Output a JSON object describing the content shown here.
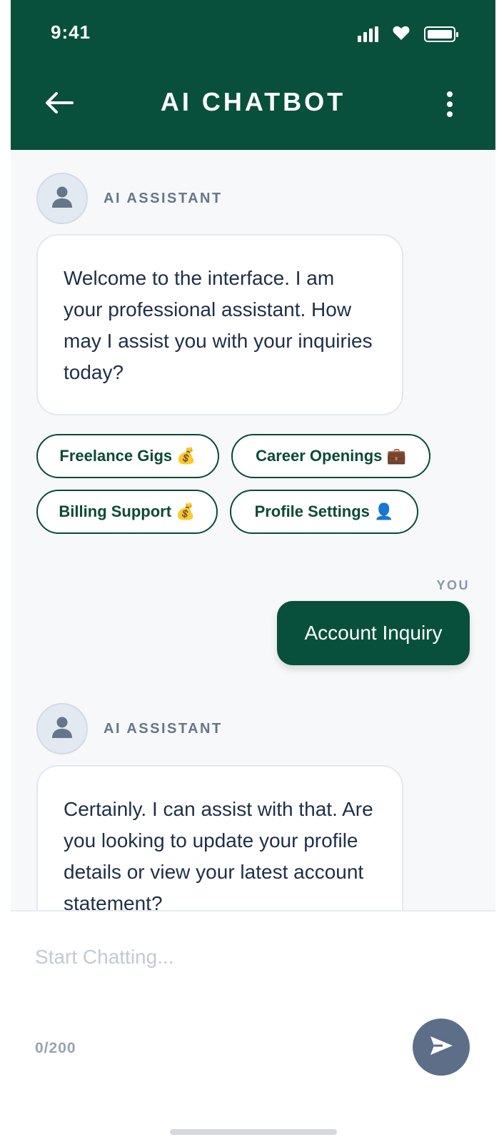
{
  "status_bar": {
    "time": "9:41"
  },
  "header": {
    "title": "AI CHATBOT"
  },
  "messages": {
    "ai1": {
      "sender": "AI ASSISTANT",
      "text": "Welcome to the interface. I am your professional assistant. How may I assist you with your inquiries today?"
    },
    "chips": [
      {
        "label": "Freelance Gigs 💰"
      },
      {
        "label": "Career Openings 💼"
      },
      {
        "label": "Billing Support 💰"
      },
      {
        "label": "Profile Settings 👤"
      }
    ],
    "user1": {
      "sender": "YOU",
      "text": "Account Inquiry"
    },
    "ai2": {
      "sender": "AI ASSISTANT",
      "text": "Certainly. I can assist with that. Are you looking to update your profile details or view your latest account statement?"
    }
  },
  "composer": {
    "placeholder": "Start Chatting...",
    "value": "",
    "counter": "0/200"
  },
  "colors": {
    "brand": "#08503b",
    "chat_bg": "#f6f8fa",
    "send_button": "#5c6e88"
  },
  "icons": {
    "back": "arrow-left-icon",
    "more": "more-vertical-icon",
    "avatar": "user-icon",
    "send": "send-icon",
    "signal": "signal-icon",
    "health": "heart-icon",
    "battery": "battery-icon"
  }
}
